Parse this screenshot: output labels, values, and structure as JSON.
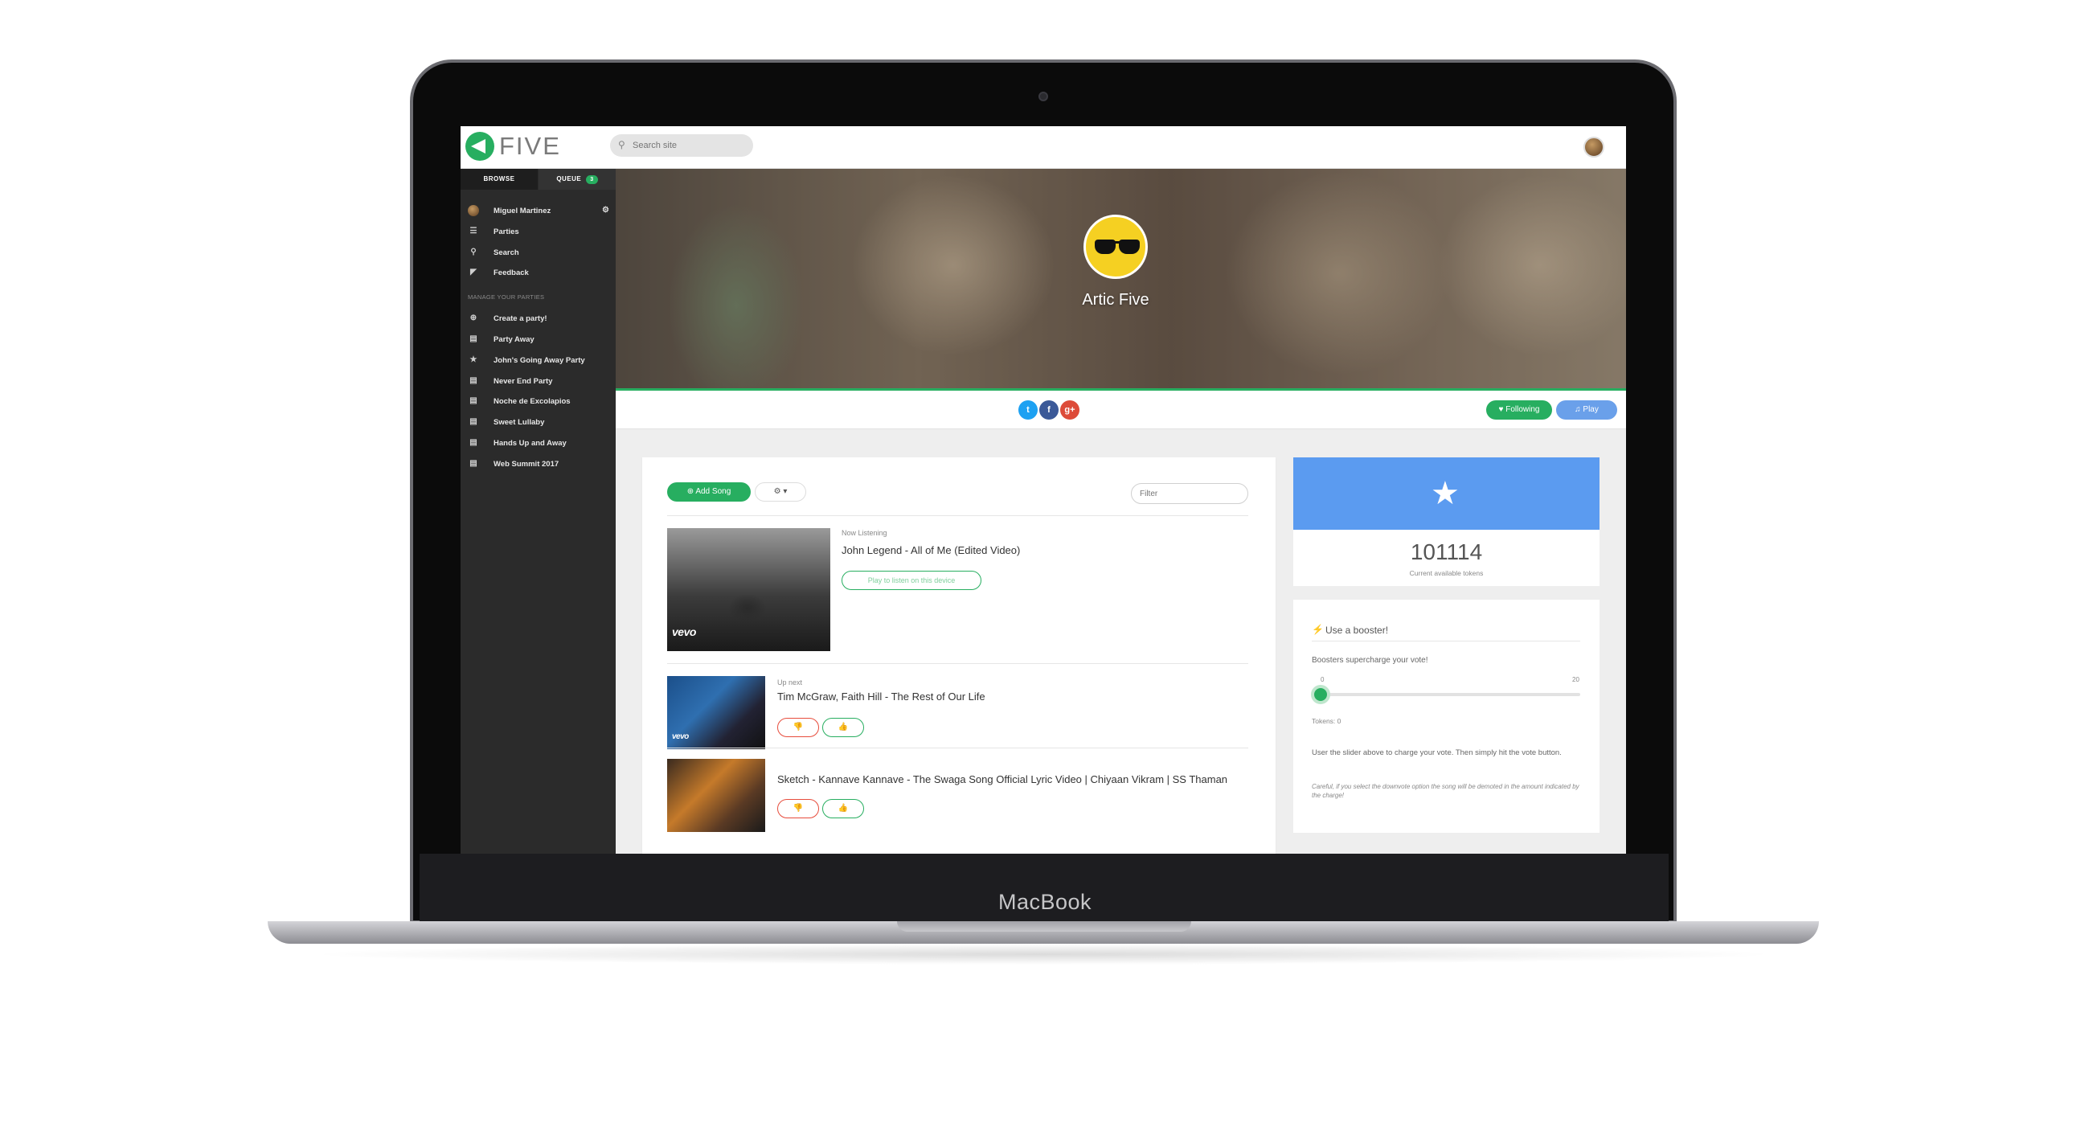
{
  "device": {
    "brand_label": "MacBook"
  },
  "topbar": {
    "logo_text": "FIVE",
    "search_placeholder": "Search site"
  },
  "sidebar": {
    "tabs": [
      {
        "label": "BROWSE"
      },
      {
        "label": "QUEUE",
        "badge": "3"
      }
    ],
    "user": {
      "name": "Miguel Martinez"
    },
    "nav": [
      {
        "label": "Parties",
        "icon": "list-icon"
      },
      {
        "label": "Search",
        "icon": "search-icon"
      },
      {
        "label": "Feedback",
        "icon": "megaphone-icon"
      }
    ],
    "section_title": "MANAGE YOUR PARTIES",
    "parties": [
      {
        "label": "Create a party!",
        "icon": "plus-circle-icon"
      },
      {
        "label": "Party Away",
        "icon": "note-icon"
      },
      {
        "label": "John's Going Away Party",
        "icon": "star-icon"
      },
      {
        "label": "Never End Party",
        "icon": "note-icon"
      },
      {
        "label": "Noche de Excolapios",
        "icon": "note-icon"
      },
      {
        "label": "Sweet Lullaby",
        "icon": "note-icon"
      },
      {
        "label": "Hands Up and Away",
        "icon": "note-icon"
      },
      {
        "label": "Web Summit 2017",
        "icon": "note-icon"
      }
    ]
  },
  "hero": {
    "party_name": "Artic Five"
  },
  "actions": {
    "following_label": "Following",
    "play_label": "Play"
  },
  "queue": {
    "add_song_label": "Add Song",
    "filter_placeholder": "Filter",
    "now": {
      "label": "Now Listening",
      "title": "John Legend - All of Me (Edited Video)",
      "listen_label": "Play to listen on this device",
      "thumb_brand": "vevo"
    },
    "up_next_label": "Up next",
    "songs": [
      {
        "title": "Tim McGraw, Faith Hill - The Rest of Our Life",
        "thumb_brand": "vevo"
      },
      {
        "title": "Sketch - Kannave Kannave - The Swaga Song Official Lyric Video | Chiyaan Vikram | SS Thaman"
      }
    ]
  },
  "tokens": {
    "value": "101114",
    "caption": "Current available tokens"
  },
  "booster": {
    "title": "Use a booster!",
    "subtitle": "Boosters supercharge your vote!",
    "min": "0",
    "max": "20",
    "tokens_label": "Tokens: 0",
    "slider_level": 0,
    "help": "User the slider above to charge your vote. Then simply hit the vote button.",
    "warning": "Careful, if you select the downvote option the song will be demoted in the amount indicated by the charge!"
  },
  "colors": {
    "accent": "#27ae60",
    "token_banner": "#5b9bf0",
    "sidebar": "#2b2b2b"
  }
}
